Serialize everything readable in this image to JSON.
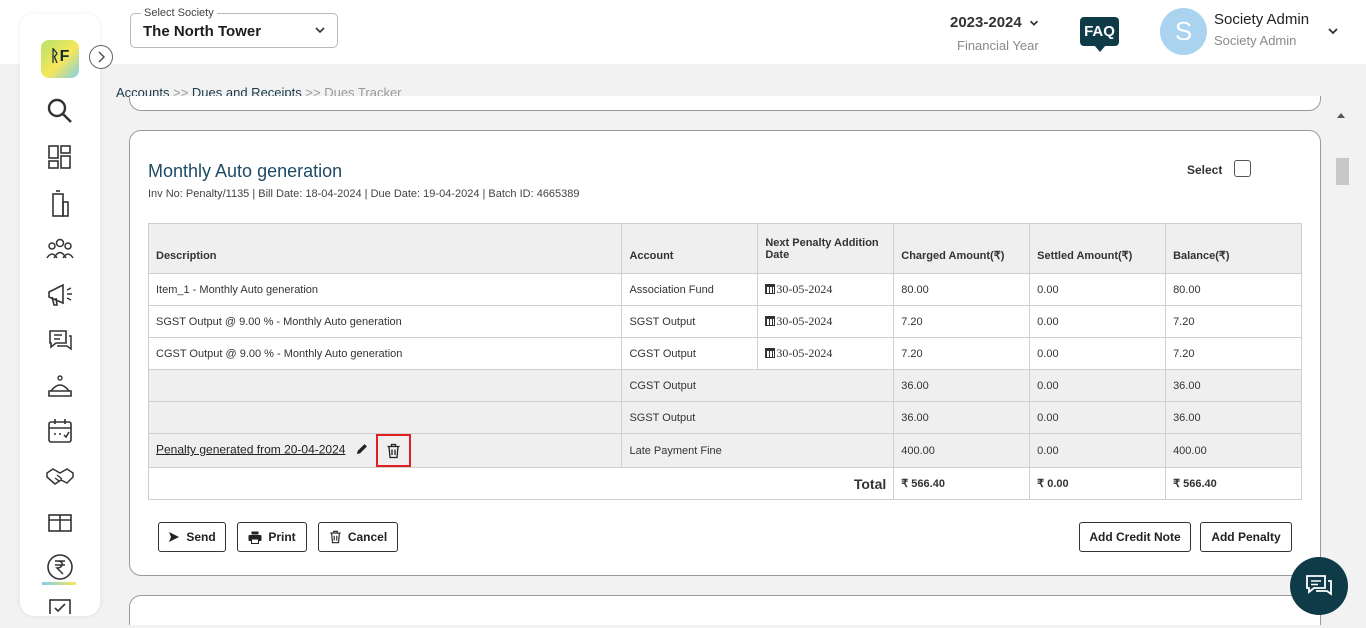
{
  "header": {
    "society_label": "Select Society",
    "society_value": "The North Tower",
    "year": "2023-2024",
    "year_sub": "Financial Year",
    "faq": "FAQ",
    "avatar_letter": "S",
    "user_name": "Society Admin",
    "user_role": "Society Admin"
  },
  "sidebar": {
    "logo_text": "ᚱF",
    "items": [
      "search-icon",
      "dashboard-icon",
      "building-icon",
      "members-icon",
      "announcement-icon",
      "chat-icon",
      "amenities-icon",
      "calendar-icon",
      "handshake-icon",
      "package-icon",
      "rupee-icon",
      "approval-icon"
    ]
  },
  "breadcrumb": {
    "crumb1": "Accounts",
    "sep1": ">>",
    "crumb2": "Dues and Receipts",
    "sep2": ">>",
    "crumb3": "Dues Tracker"
  },
  "card": {
    "title": "Monthly Auto generation",
    "meta": "Inv No: Penalty/1135 | Bill Date: 18-04-2024 | Due Date: 19-04-2024 | Batch ID: 4665389",
    "select_label": "Select",
    "columns": [
      "Description",
      "Account",
      "Next Penalty Addition Date",
      "Charged Amount(₹)",
      "Settled Amount(₹)",
      "Balance(₹)"
    ],
    "rows": [
      {
        "desc": "Item_1 - Monthly Auto generation",
        "account": "Association Fund",
        "date": "30-05-2024",
        "charged": "80.00",
        "settled": "0.00",
        "balance": "80.00"
      },
      {
        "desc": "SGST Output @ 9.00 % - Monthly Auto generation",
        "account": "SGST Output",
        "date": "30-05-2024",
        "charged": "7.20",
        "settled": "0.00",
        "balance": "7.20"
      },
      {
        "desc": "CGST Output @ 9.00 % - Monthly Auto generation",
        "account": "CGST Output",
        "date": "30-05-2024",
        "charged": "7.20",
        "settled": "0.00",
        "balance": "7.20"
      }
    ],
    "tax_rows": [
      {
        "account": "CGST Output",
        "charged": "36.00",
        "settled": "0.00",
        "balance": "36.00"
      },
      {
        "account": "SGST Output",
        "charged": "36.00",
        "settled": "0.00",
        "balance": "36.00"
      }
    ],
    "penalty_row": {
      "desc": "Penalty generated from 20-04-2024",
      "account": "Late Payment Fine",
      "charged": "400.00",
      "settled": "0.00",
      "balance": "400.00"
    },
    "total": {
      "label": "Total",
      "charged": "₹ 566.40",
      "settled": "₹ 0.00",
      "balance": "₹ 566.40"
    },
    "buttons": {
      "send": "Send",
      "print": "Print",
      "cancel": "Cancel",
      "add_credit_note": "Add Credit Note",
      "add_penalty": "Add Penalty"
    }
  }
}
